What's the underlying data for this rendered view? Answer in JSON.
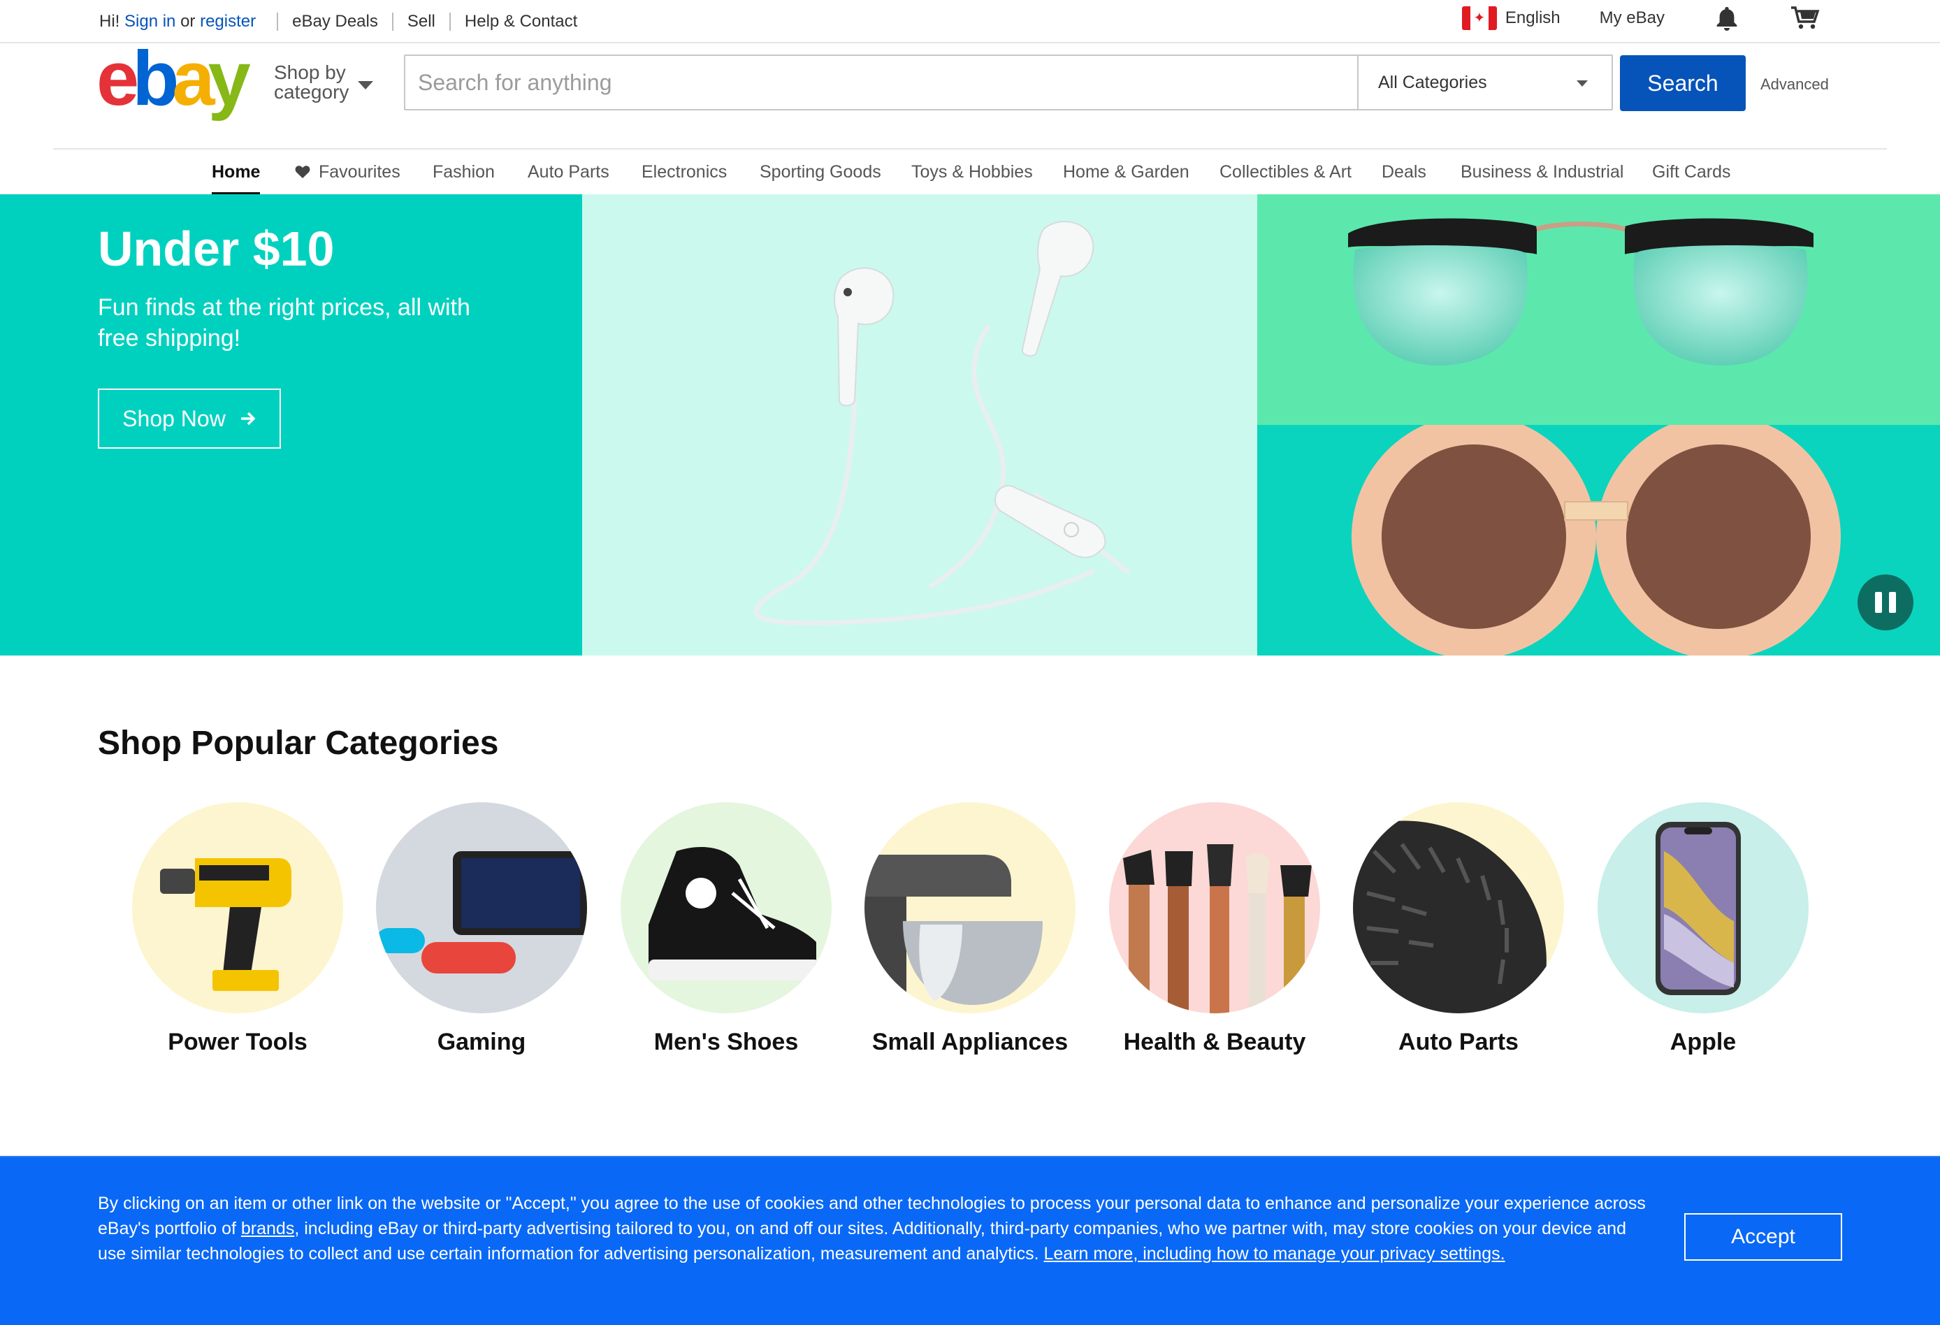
{
  "topbar": {
    "greeting": "Hi!",
    "sign_in": "Sign in",
    "or": "or",
    "register": "register",
    "links": [
      "eBay Deals",
      "Sell",
      "Help & Contact"
    ],
    "language": "English",
    "my_ebay": "My eBay"
  },
  "header": {
    "logo_letters": [
      "e",
      "b",
      "a",
      "y"
    ],
    "shop_by_category": "Shop by category",
    "search_placeholder": "Search for anything",
    "category_selected": "All Categories",
    "search_button": "Search",
    "advanced": "Advanced"
  },
  "nav": {
    "items": [
      "Home",
      "Favourites",
      "Fashion",
      "Auto Parts",
      "Electronics",
      "Sporting Goods",
      "Toys & Hobbies",
      "Home & Garden",
      "Collectibles & Art",
      "Deals",
      "Business & Industrial",
      "Gift Cards"
    ],
    "active": "Home"
  },
  "hero": {
    "title": "Under $10",
    "subtitle": "Fun finds at the right prices, all with free shipping!",
    "button": "Shop Now",
    "colors": {
      "left": "#00d1bf",
      "middle": "#cbf9ee",
      "right_top": "#5ce8ad",
      "right_bottom": "#0ad4bd"
    }
  },
  "categories": {
    "title": "Shop Popular Categories",
    "items": [
      {
        "label": "Power Tools",
        "bg": "#fdf5cf",
        "icon": "drill-icon"
      },
      {
        "label": "Gaming",
        "bg": "#d3d9df",
        "icon": "game-console-icon"
      },
      {
        "label": "Men's Shoes",
        "bg": "#e4f6dd",
        "icon": "sneaker-icon"
      },
      {
        "label": "Small Appliances",
        "bg": "#fdf5cf",
        "icon": "stand-mixer-icon"
      },
      {
        "label": "Health & Beauty",
        "bg": "#fcd9d6",
        "icon": "makeup-brushes-icon"
      },
      {
        "label": "Auto Parts",
        "bg": "#fdf5cf",
        "icon": "tire-icon"
      },
      {
        "label": "Apple",
        "bg": "#c8efea",
        "icon": "smartphone-icon"
      }
    ]
  },
  "cookie": {
    "text_1": "By clicking on an item or other link on the website or \"Accept,\" you agree to the use of cookies and other technologies to process your personal data to enhance and personalize your experience across eBay's portfolio of ",
    "brands_link": "brands",
    "text_2": ", including eBay or third-party advertising tailored to you, on and off our sites. Additionally, third-party companies, who we partner with, may store cookies on your device and use similar technologies to collect and use certain information for advertising personalization, measurement and analytics. ",
    "learn_more_link": "Learn more, including how to manage your privacy settings.",
    "accept_button": "Accept"
  }
}
